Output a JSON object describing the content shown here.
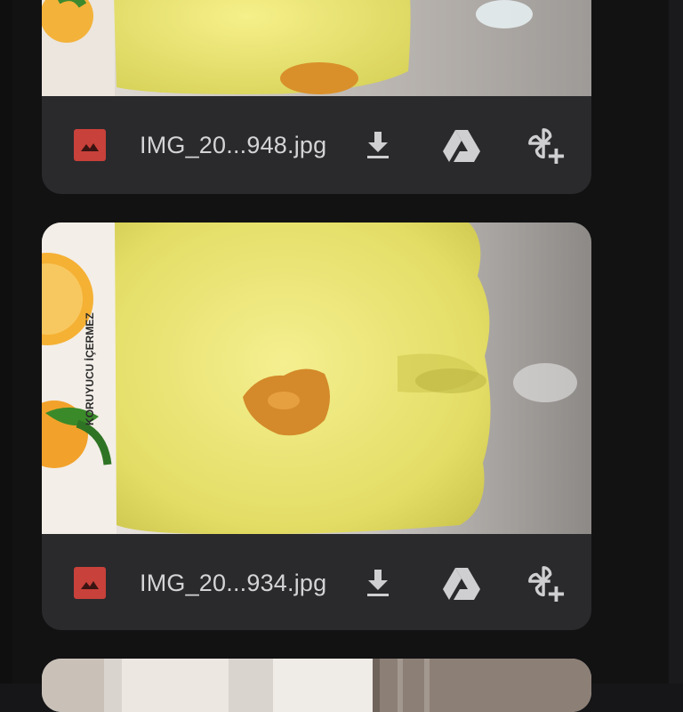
{
  "files": [
    {
      "filename": "IMG_20...948.jpg",
      "icon": "image-icon"
    },
    {
      "filename": "IMG_20...934.jpg",
      "icon": "image-icon"
    }
  ],
  "actions": {
    "download": "download-icon",
    "drive": "google-drive-icon",
    "photos": "google-photos-icon"
  },
  "photo_label": "KORUYUCU İÇERMEZ",
  "colors": {
    "background": "#121213",
    "card": "#2a2a2d",
    "image_badge": "#c8413a",
    "icon": "#cfcfd1",
    "text": "#d4d4d6"
  }
}
